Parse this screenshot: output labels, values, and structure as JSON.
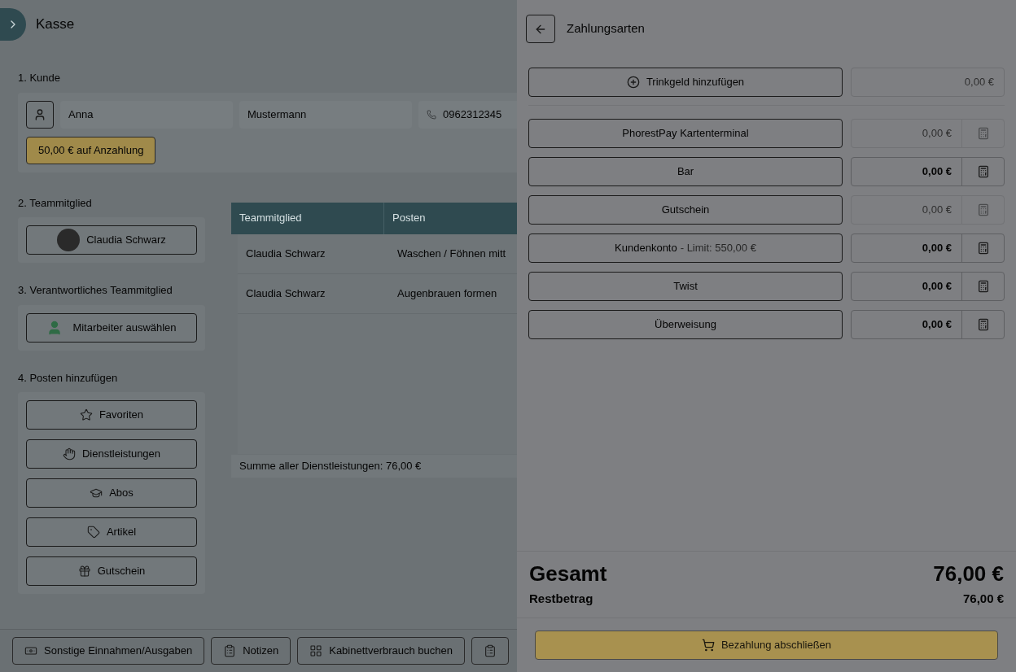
{
  "page": {
    "title": "Kasse"
  },
  "customer": {
    "heading": "1. Kunde",
    "first_name": "Anna",
    "last_name": "Mustermann",
    "phone": "0962312345",
    "deposit_badge": "50,00 € auf Anzahlung"
  },
  "team_member": {
    "heading": "2. Teammitglied",
    "name": "Claudia Schwarz"
  },
  "responsible": {
    "heading": "3. Verantwortliches Teammitglied",
    "button": "Mitarbeiter auswählen"
  },
  "add_items": {
    "heading": "4. Posten hinzufügen",
    "buttons": [
      {
        "kind": "star",
        "label": "Favoriten"
      },
      {
        "kind": "hand",
        "label": "Dienstleistungen"
      },
      {
        "kind": "cap",
        "label": "Abos"
      },
      {
        "kind": "tag",
        "label": "Artikel"
      },
      {
        "kind": "gift",
        "label": "Gutschein"
      }
    ]
  },
  "table": {
    "columns": [
      "Teammitglied",
      "Posten"
    ],
    "rows": [
      [
        "Claudia Schwarz",
        "Waschen / Föhnen mitt"
      ],
      [
        "Claudia Schwarz",
        "Augenbrauen formen"
      ]
    ],
    "summary": "Summe aller Dienstleistungen: 76,00 €"
  },
  "footer_buttons": [
    {
      "kind": "cash",
      "label": "Sonstige Einnahmen/Ausgaben"
    },
    {
      "kind": "clipboard",
      "label": "Notizen"
    },
    {
      "kind": "grid",
      "label": "Kabinettverbrauch buchen"
    },
    {
      "kind": "clipboard"
    }
  ],
  "panel": {
    "title": "Zahlungsarten",
    "tip": {
      "label": "Trinkgeld hinzufügen",
      "amount": "0,00 €"
    },
    "methods": [
      {
        "label": "PhorestPay Kartenterminal",
        "amount": "0,00 €",
        "disabled": true
      },
      {
        "label": "Bar",
        "amount": "0,00 €",
        "disabled": false
      },
      {
        "label": "Gutschein",
        "amount": "0,00 €",
        "disabled": true
      },
      {
        "label": "Kundenkonto",
        "note": "- Limit: 550,00 €",
        "amount": "0,00 €",
        "disabled": false
      },
      {
        "label": "Twist",
        "amount": "0,00 €",
        "disabled": false
      },
      {
        "label": "Überweisung",
        "amount": "0,00 €",
        "disabled": false
      }
    ],
    "total_label": "Gesamt",
    "total": "76,00 €",
    "rest_label": "Restbetrag",
    "rest": "76,00 €",
    "submit": "Bezahlung abschließen"
  }
}
